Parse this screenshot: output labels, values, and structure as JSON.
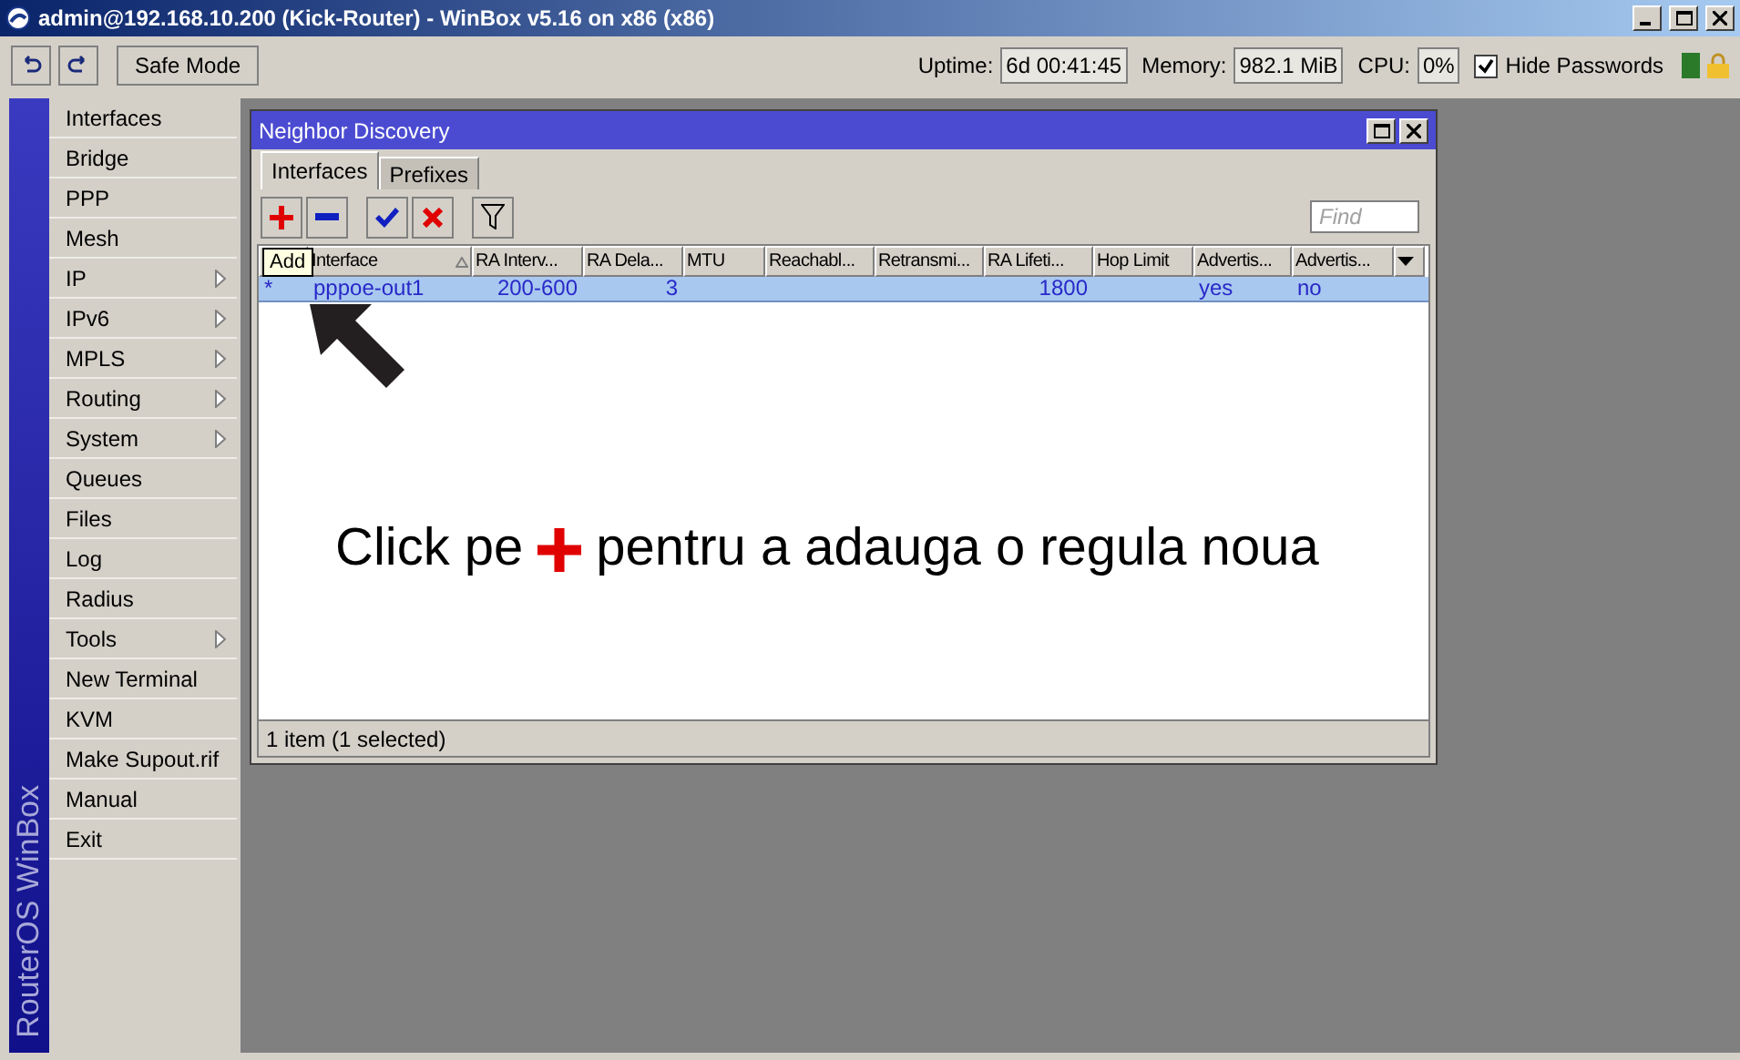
{
  "window": {
    "title": "admin@192.168.10.200 (Kick-Router) - WinBox v5.16 on x86 (x86)"
  },
  "toolbar": {
    "safe_mode": "Safe Mode",
    "status": [
      {
        "label": "Uptime:",
        "value": "6d 00:41:45"
      },
      {
        "label": "Memory:",
        "value": "982.1 MiB"
      },
      {
        "label": "CPU:",
        "value": "0%"
      }
    ],
    "hide_passwords": {
      "label": "Hide Passwords",
      "checked": true
    }
  },
  "sidebar": {
    "brand": "RouterOS WinBox",
    "items": [
      {
        "label": "Interfaces",
        "submenu": false
      },
      {
        "label": "Bridge",
        "submenu": false
      },
      {
        "label": "PPP",
        "submenu": false
      },
      {
        "label": "Mesh",
        "submenu": false
      },
      {
        "label": "IP",
        "submenu": true
      },
      {
        "label": "IPv6",
        "submenu": true
      },
      {
        "label": "MPLS",
        "submenu": true
      },
      {
        "label": "Routing",
        "submenu": true
      },
      {
        "label": "System",
        "submenu": true
      },
      {
        "label": "Queues",
        "submenu": false
      },
      {
        "label": "Files",
        "submenu": false
      },
      {
        "label": "Log",
        "submenu": false
      },
      {
        "label": "Radius",
        "submenu": false
      },
      {
        "label": "Tools",
        "submenu": true
      },
      {
        "label": "New Terminal",
        "submenu": false
      },
      {
        "label": "KVM",
        "submenu": false
      },
      {
        "label": "Make Supout.rif",
        "submenu": false
      },
      {
        "label": "Manual",
        "submenu": false
      },
      {
        "label": "Exit",
        "submenu": false
      }
    ]
  },
  "dialog": {
    "title": "Neighbor Discovery",
    "tabs": [
      {
        "label": "Interfaces",
        "selected": true
      },
      {
        "label": "Prefixes",
        "selected": false
      }
    ],
    "actions": [
      {
        "kind": "add"
      },
      {
        "kind": "remove"
      },
      {
        "kind": "enable"
      },
      {
        "kind": "disable"
      },
      {
        "kind": "filter"
      }
    ],
    "tooltip": "Add",
    "search": {
      "placeholder": "Find"
    },
    "table": {
      "columns": [
        {
          "label": "Interface",
          "kind": "text",
          "sorted": true
        },
        {
          "label": "RA Interv...",
          "kind": "number",
          "sorted": false
        },
        {
          "label": "RA Dela...",
          "kind": "number",
          "sorted": false
        },
        {
          "label": "MTU",
          "sorted": false
        },
        {
          "label": "Reachabl...",
          "sorted": false
        },
        {
          "label": "Retransmi...",
          "sorted": false
        },
        {
          "label": "RA Lifeti...",
          "kind": "number",
          "sorted": false
        },
        {
          "label": "Hop Limit",
          "sorted": false
        },
        {
          "label": "Advertis...",
          "kind": "text",
          "sorted": false
        },
        {
          "label": "Advertis...",
          "kind": "text",
          "sorted": false
        }
      ],
      "rows": [
        {
          "marker": "*",
          "selected": true,
          "cells": [
            "pppoe-out1",
            "200-600",
            "3",
            null,
            null,
            null,
            "1800",
            null,
            "yes",
            "no"
          ]
        }
      ]
    },
    "status_bar": "1 item (1 selected)"
  },
  "annotation": {
    "before": "Click pe",
    "after": "pentru a adauga o regula noua"
  }
}
